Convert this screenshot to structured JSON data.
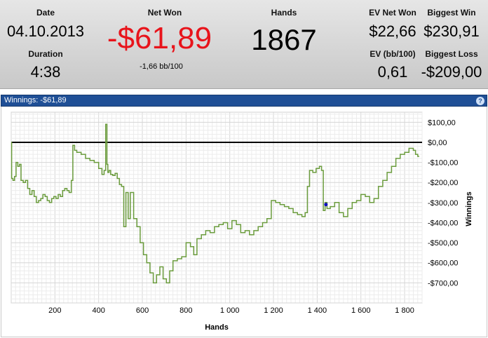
{
  "stats": {
    "date_label": "Date",
    "date_value": "04.10.2013",
    "duration_label": "Duration",
    "duration_value": "4:38",
    "net_won_label": "Net Won",
    "net_won_value": "-$61,89",
    "bb_per_100": "-1,66 bb/100",
    "hands_label": "Hands",
    "hands_value": "1867",
    "ev_net_won_label": "EV Net Won",
    "ev_net_won_value": "$22,66",
    "biggest_win_label": "Biggest Win",
    "biggest_win_value": "$230,91",
    "ev_bb_label": "EV (bb/100)",
    "ev_bb_value": "0,61",
    "biggest_loss_label": "Biggest Loss",
    "biggest_loss_value": "-$209,00"
  },
  "colors": {
    "negative": "#e8141b",
    "line": "#6a9b3c",
    "marker": "#1010c0",
    "titlebar": "#1f4f96"
  },
  "panel": {
    "title": "Winnings:  -$61,89",
    "help_glyph": "?"
  },
  "chart_data": {
    "type": "line",
    "xlabel": "Hands",
    "ylabel": "Winnings",
    "xlim": [
      0,
      1880
    ],
    "ylim": [
      -800,
      150
    ],
    "x_ticks": [
      200,
      400,
      600,
      800,
      1000,
      1200,
      1400,
      1600,
      1800
    ],
    "x_tick_labels": [
      "200",
      "400",
      "600",
      "800",
      "1 000",
      "1 200",
      "1 400",
      "1 600",
      "1 800"
    ],
    "y_ticks": [
      100,
      0,
      -100,
      -200,
      -300,
      -400,
      -500,
      -600,
      -700
    ],
    "y_tick_labels": [
      "$100,00",
      "$0,00",
      "-$100,00",
      "-$200,00",
      "-$300,00",
      "-$400,00",
      "-$500,00",
      "-$600,00",
      "-$700,00"
    ],
    "grid": true,
    "zero_line": true,
    "marker_point": {
      "x": 1440,
      "y": -310
    },
    "series": [
      {
        "x": [
          0,
          2,
          8,
          15,
          22,
          30,
          38,
          45,
          55,
          65,
          75,
          85,
          95,
          105,
          115,
          125,
          135,
          145,
          155,
          165,
          175,
          185,
          195,
          205,
          215,
          225,
          235,
          245,
          255,
          265,
          275,
          282,
          290,
          300,
          320,
          340,
          360,
          380,
          400,
          415,
          425,
          432,
          438,
          442,
          448,
          455,
          465,
          475,
          485,
          495,
          505,
          515,
          525,
          535,
          545,
          560,
          575,
          590,
          605,
          620,
          635,
          650,
          665,
          680,
          695,
          710,
          725,
          740,
          760,
          780,
          800,
          820,
          835,
          850,
          870,
          890,
          910,
          930,
          950,
          970,
          990,
          1010,
          1030,
          1050,
          1070,
          1090,
          1110,
          1130,
          1150,
          1170,
          1190,
          1210,
          1230,
          1250,
          1270,
          1290,
          1310,
          1330,
          1345,
          1355,
          1365,
          1380,
          1395,
          1410,
          1420,
          1428,
          1436,
          1445,
          1460,
          1480,
          1500,
          1520,
          1540,
          1560,
          1580,
          1600,
          1620,
          1640,
          1660,
          1680,
          1700,
          1720,
          1740,
          1760,
          1780,
          1800,
          1820,
          1840,
          1850,
          1860,
          1867
        ],
        "y": [
          0,
          -180,
          -190,
          -170,
          -100,
          -120,
          -110,
          -190,
          -200,
          -190,
          -230,
          -260,
          -240,
          -270,
          -300,
          -290,
          -280,
          -260,
          -270,
          -290,
          -300,
          -280,
          -270,
          -280,
          -260,
          -270,
          -240,
          -230,
          -240,
          -250,
          -190,
          -15,
          -40,
          -50,
          -60,
          -80,
          -90,
          -100,
          -130,
          -160,
          -140,
          90,
          -110,
          -150,
          -140,
          -160,
          -165,
          -155,
          -180,
          -210,
          -220,
          -420,
          -250,
          -380,
          -250,
          -380,
          -420,
          -500,
          -560,
          -600,
          -650,
          -700,
          -660,
          -620,
          -680,
          -700,
          -640,
          -590,
          -580,
          -570,
          -500,
          -520,
          -560,
          -480,
          -460,
          -440,
          -450,
          -420,
          -410,
          -400,
          -430,
          -390,
          -410,
          -450,
          -440,
          -460,
          -440,
          -420,
          -400,
          -380,
          -290,
          -300,
          -310,
          -320,
          -330,
          -350,
          -360,
          -370,
          -350,
          -220,
          -140,
          -150,
          -130,
          -120,
          -140,
          -340,
          -300,
          -330,
          -320,
          -300,
          -350,
          -370,
          -330,
          -300,
          -290,
          -260,
          -270,
          -300,
          -280,
          -220,
          -190,
          -150,
          -120,
          -80,
          -60,
          -50,
          -30,
          -40,
          -60,
          -70,
          -70
        ]
      }
    ]
  }
}
